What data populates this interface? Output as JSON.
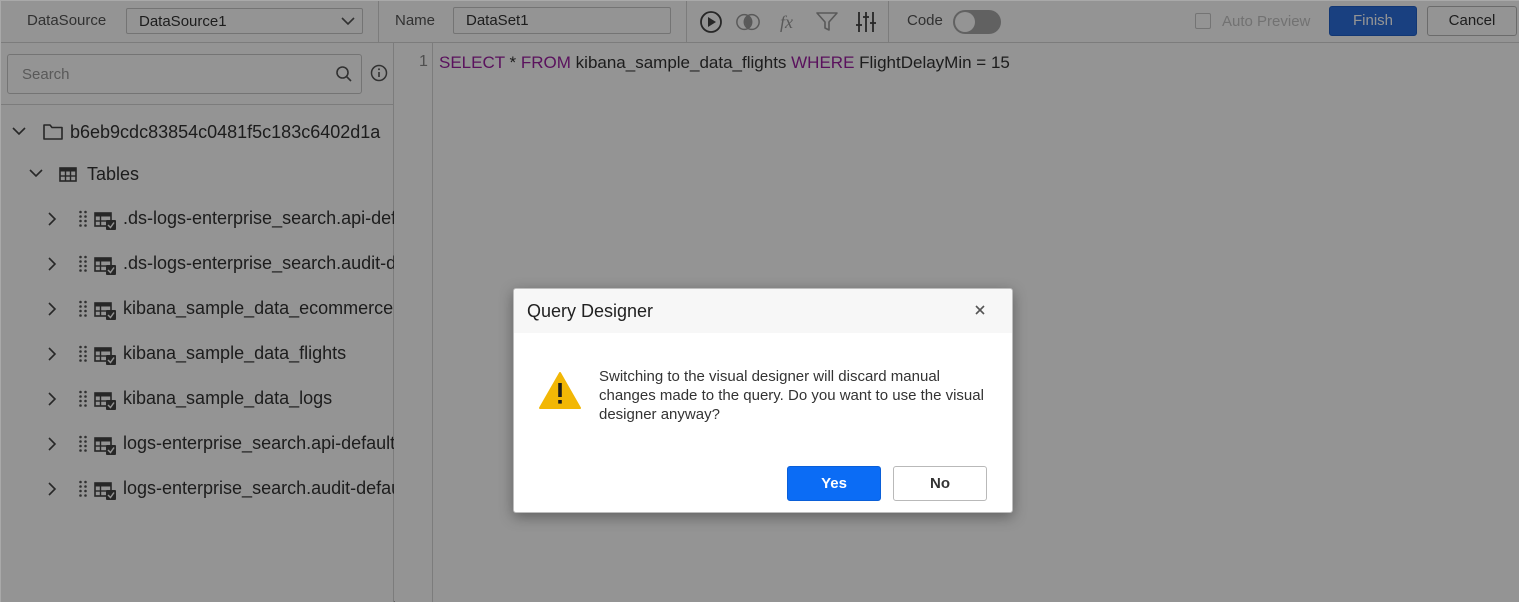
{
  "toolbar": {
    "datasource_label": "DataSource",
    "datasource_value": "DataSource1",
    "name_label": "Name",
    "name_value": "DataSet1",
    "code_label": "Code",
    "code_toggle_on": false,
    "auto_preview_label": "Auto Preview",
    "auto_preview_checked": false,
    "finish_label": "Finish",
    "cancel_label": "Cancel",
    "icons": [
      "run-icon",
      "join-icon",
      "function-icon",
      "filter-icon",
      "settings-sliders-icon"
    ]
  },
  "sidebar": {
    "search_placeholder": "Search",
    "root_label": "b6eb9cdc83854c0481f5c183c6402d1a",
    "tables_label": "Tables",
    "items": [
      {
        "label": ".ds-logs-enterprise_search.api-default"
      },
      {
        "label": ".ds-logs-enterprise_search.audit-default"
      },
      {
        "label": "kibana_sample_data_ecommerce"
      },
      {
        "label": "kibana_sample_data_flights"
      },
      {
        "label": "kibana_sample_data_logs"
      },
      {
        "label": "logs-enterprise_search.api-default"
      },
      {
        "label": "logs-enterprise_search.audit-default"
      }
    ]
  },
  "editor": {
    "line_number": "1",
    "tokens": {
      "select": "SELECT",
      "star": " * ",
      "from": "FROM",
      "table": " kibana_sample_data_flights ",
      "where": "WHERE",
      "condition": " FlightDelayMin = 15"
    }
  },
  "dialog": {
    "title": "Query Designer",
    "message": "Switching to the visual designer will discard manual changes made to the query. Do you want to use the visual designer anyway?",
    "yes_label": "Yes",
    "no_label": "No"
  },
  "colors": {
    "primary": "#0b6cf5",
    "finish": "#2b6fdc",
    "keyword": "#9b1fa0",
    "warning": "#f2b705"
  }
}
